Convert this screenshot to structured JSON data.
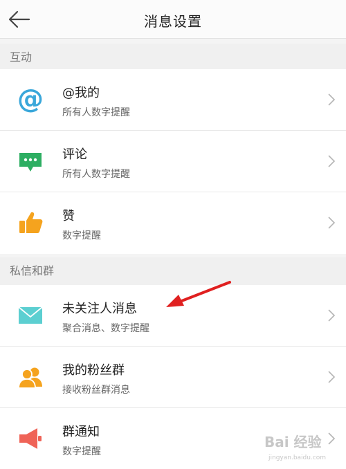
{
  "header": {
    "title": "消息设置",
    "back_icon": "back-arrow-icon"
  },
  "sections": [
    {
      "title": "互动",
      "items": [
        {
          "label": "@我的",
          "sub": "所有人数字提醒",
          "icon": "at-icon",
          "color": "#3aa7da"
        },
        {
          "label": "评论",
          "sub": "所有人数字提醒",
          "icon": "comment-icon",
          "color": "#2dae62"
        },
        {
          "label": "赞",
          "sub": "数字提醒",
          "icon": "thumbs-up-icon",
          "color": "#f5a31e"
        }
      ]
    },
    {
      "title": "私信和群",
      "items": [
        {
          "label": "未关注人消息",
          "sub": "聚合消息、数字提醒",
          "icon": "envelope-icon",
          "color": "#5ccfd1"
        },
        {
          "label": "我的粉丝群",
          "sub": "接收粉丝群消息",
          "icon": "fans-group-icon",
          "color": "#f5a31e"
        },
        {
          "label": "群通知",
          "sub": "数字提醒",
          "icon": "speaker-icon",
          "color": "#ef6357"
        }
      ]
    }
  ],
  "annotation": {
    "arrow_color": "#e02020"
  },
  "watermark": {
    "brand": "Bai 经验",
    "url": "jingyan.baidu.com"
  }
}
